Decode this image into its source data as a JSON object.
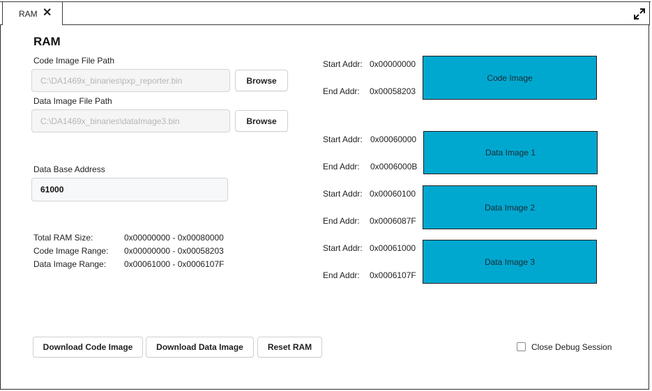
{
  "tab": {
    "label": "RAM"
  },
  "page": {
    "title": "RAM"
  },
  "code_image": {
    "label": "Code Image File Path",
    "value": "C:\\DA1469x_binaries\\pxp_reporter.bin",
    "browse_label": "Browse"
  },
  "data_image": {
    "label": "Data Image File Path",
    "value": "C:\\DA1469x_binaries\\dataImage3.bin",
    "browse_label": "Browse"
  },
  "data_base": {
    "label": "Data Base Address",
    "value": "61000"
  },
  "info": {
    "total_label": "Total RAM Size:",
    "total_value": "0x00000000 - 0x00080000",
    "code_label": "Code Image Range:",
    "code_value": "0x00000000 - 0x00058203",
    "data_label": "Data Image Range:",
    "data_value": "0x00061000 - 0x0006107F"
  },
  "memory_map": {
    "start_label": "Start Addr:",
    "end_label": "End Addr:",
    "block_color": "#00a8d0",
    "blocks": [
      {
        "name": "Code Image",
        "start": "0x00000000",
        "end": "0x00058203"
      },
      {
        "name": "Data Image 1",
        "start": "0x00060000",
        "end": "0x0006000B"
      },
      {
        "name": "Data Image 2",
        "start": "0x00060100",
        "end": "0x0006087F"
      },
      {
        "name": "Data Image 3",
        "start": "0x00061000",
        "end": "0x0006107F"
      }
    ]
  },
  "actions": {
    "download_code": "Download Code Image",
    "download_data": "Download Data Image",
    "reset": "Reset RAM"
  },
  "close_debug": {
    "label": "Close Debug Session",
    "checked": false
  }
}
